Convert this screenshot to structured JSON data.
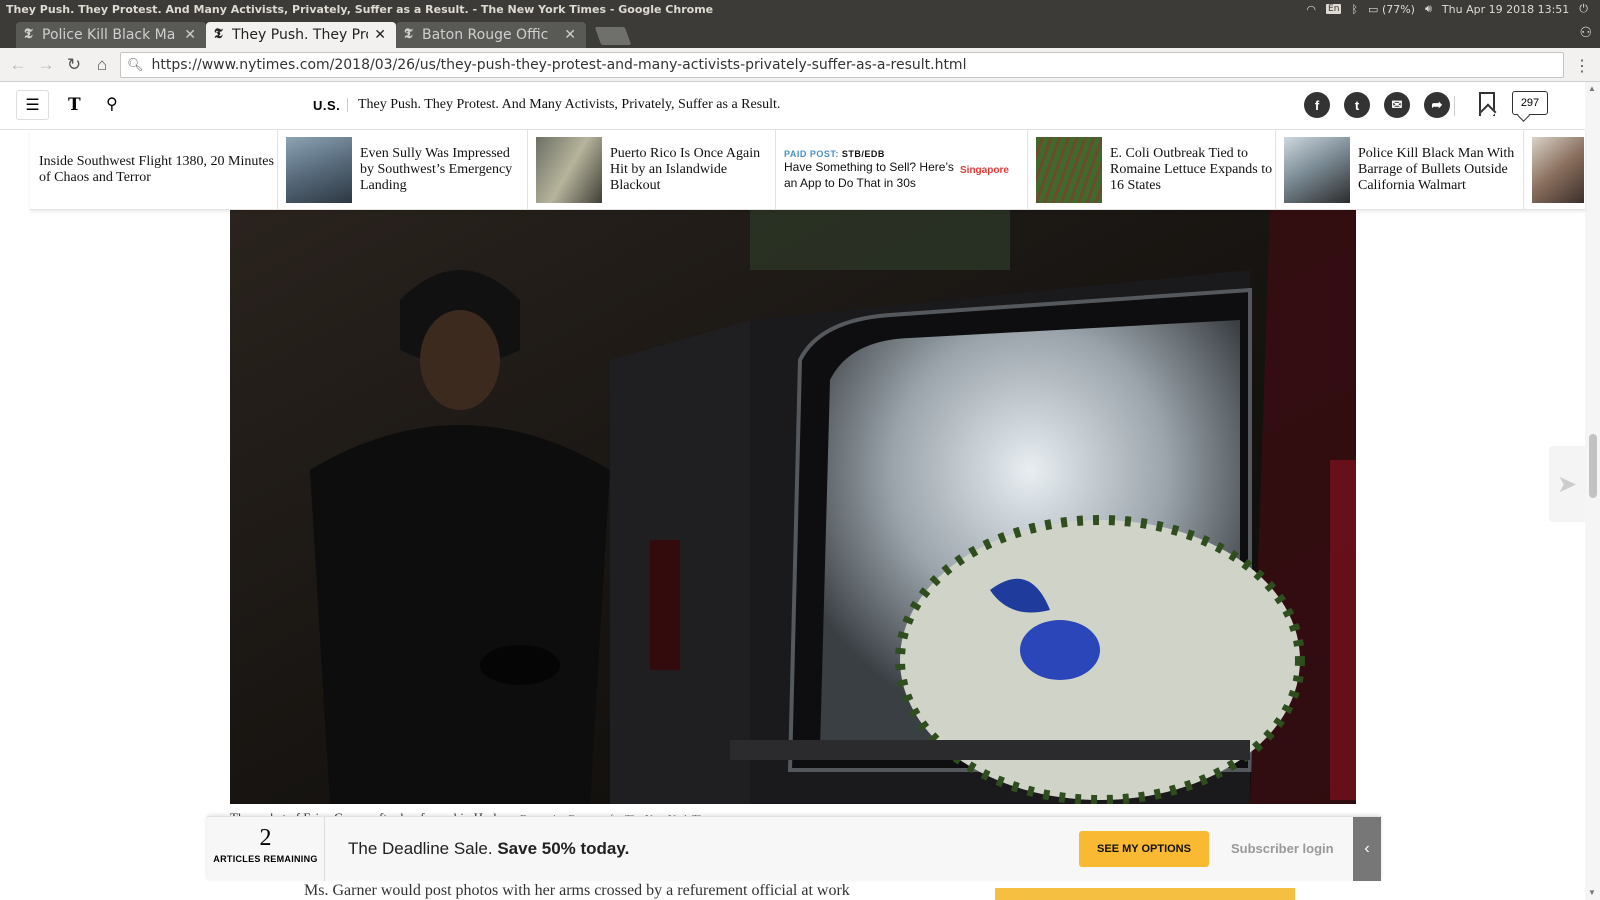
{
  "os": {
    "window_title": "They Push. They Protest. And Many Activists, Privately, Suffer as a Result. - The New York Times - Google Chrome",
    "keyboard": "En",
    "battery": "(77%)",
    "datetime": "Thu Apr 19 2018 13:51"
  },
  "tabs": [
    {
      "label": "Police Kill Black Ma",
      "active": false
    },
    {
      "label": "They Push. They Pro",
      "active": true
    },
    {
      "label": "Baton Rouge Offic",
      "active": false
    }
  ],
  "browser": {
    "url": "https://www.nytimes.com/2018/03/26/us/they-push-they-protest-and-many-activists-privately-suffer-as-a-result.html"
  },
  "header": {
    "logo": "T",
    "section": "U.S.",
    "headline": "They Push. They Protest. And Many Activists, Privately, Suffer as a Result.",
    "comment_count": "297"
  },
  "ribbon": [
    {
      "text": "Inside Southwest Flight 1380, 20 Minutes of Chaos and Terror"
    },
    {
      "text": "Even Sully Was Impressed by Southwest’s Emergency Landing"
    },
    {
      "text": "Puerto Rico Is Once Again Hit by an Islandwide Blackout"
    },
    {
      "paid_label": "PAID POST:",
      "sponsor": "STB/EDB",
      "text": "Have Something to Sell? Here’s an App to Do That in 30s",
      "logo": "Singapore"
    },
    {
      "text": "E. Coli Outbreak Tied to Romaine Lettuce Expands to 16 States"
    },
    {
      "text": "Police Kill Black Man With Barrage of Bullets Outside California Walmart"
    }
  ],
  "photo": {
    "caption": "The casket of Erica Garner after her funeral in Harlem.",
    "credit": "Demetrius Freeman for The New York Times"
  },
  "meter": {
    "count": "2",
    "count_label": "ARTICLES REMAINING",
    "message_plain": "The Deadline Sale.",
    "message_bold": "Save 50% today.",
    "cta": "SEE MY OPTIONS",
    "login": "Subscriber login"
  },
  "article_peek": "Ms. Garner would post photos with her arms crossed by a refurement official at work"
}
